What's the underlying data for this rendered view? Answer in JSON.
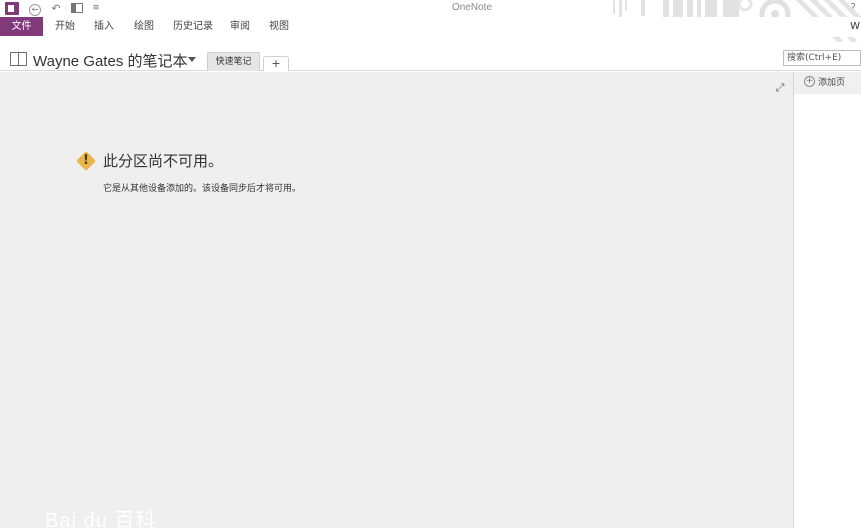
{
  "app": {
    "title": "OneNote",
    "help": "?"
  },
  "quick_access": {
    "back": "←",
    "undo": "↶",
    "more": "≡"
  },
  "ribbon": {
    "file": "文件",
    "tabs": [
      "开始",
      "插入",
      "绘图",
      "历史记录",
      "审阅",
      "视图"
    ]
  },
  "user": {
    "name": "W"
  },
  "notebook": {
    "title": "Wayne Gates 的笔记本",
    "section_tab": "快速笔记",
    "add_section": "+"
  },
  "search": {
    "placeholder": "搜索(Ctrl+E)"
  },
  "content": {
    "heading": "此分区尚不可用。",
    "body": "它是从其他设备添加的。该设备同步后才将可用。",
    "warning_glyph": "!"
  },
  "page_pane": {
    "add_page": "添加页",
    "add_icon": "+"
  },
  "watermark": "Bai du 百科",
  "colors": {
    "accent": "#80397b",
    "warning": "#e8b64b",
    "canvas": "#efefef"
  },
  "icons": {
    "app": "onenote-logo-icon",
    "back": "back-arrow-icon",
    "undo": "undo-icon",
    "dock": "dock-to-desktop-icon",
    "notebook": "notebook-icon",
    "expand": "expand-icon",
    "warning": "warning-icon",
    "add_page": "add-page-icon"
  }
}
